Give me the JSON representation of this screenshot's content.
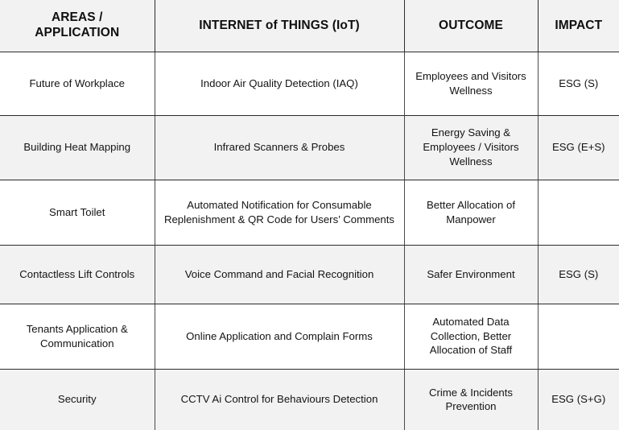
{
  "table": {
    "columns": [
      {
        "key": "areas",
        "label": "AREAS /\nAPPLICATION",
        "label_line1": "AREAS /",
        "label_line2": "APPLICATION"
      },
      {
        "key": "iot",
        "label": "INTERNET of THINGS (IoT)"
      },
      {
        "key": "outcome",
        "label": "OUTCOME"
      },
      {
        "key": "impact",
        "label": "IMPACT"
      }
    ],
    "header": {
      "areas_line1": "AREAS /",
      "areas_line2": "APPLICATION",
      "iot": "INTERNET of THINGS (IoT)",
      "outcome": "OUTCOME",
      "impact": "IMPACT"
    },
    "rows": [
      {
        "areas": "Future of Workplace",
        "iot": "Indoor Air Quality Detection (IAQ)",
        "outcome": "Employees and Visitors Wellness",
        "impact": "ESG (S)"
      },
      {
        "areas": "Building Heat Mapping",
        "iot": "Infrared Scanners & Probes",
        "outcome": "Energy Saving & Employees / Visitors Wellness",
        "impact": "ESG (E+S)"
      },
      {
        "areas": "Smart Toilet",
        "iot": "Automated Notification for Consumable Replenishment & QR Code for Users’ Comments",
        "outcome": "Better Allocation of Manpower",
        "impact": ""
      },
      {
        "areas": "Contactless Lift Controls",
        "iot": "Voice Command and Facial Recognition",
        "outcome": "Safer Environment",
        "impact": "ESG (S)"
      },
      {
        "areas": "Tenants Application & Communication",
        "iot": "Online Application and Complain Forms",
        "outcome": "Automated Data Collection, Better Allocation of Staff",
        "impact": ""
      },
      {
        "areas": "Security",
        "iot": "CCTV Ai Control for Behaviours Detection",
        "outcome": "Crime & Incidents Prevention",
        "impact": "ESG (S+G)"
      }
    ]
  },
  "colors": {
    "header_background": "#f2f2f2",
    "shaded_row_background": "#f2f2f2",
    "plain_row_background": "#ffffff",
    "border": "#2b2b2b",
    "text": "#141414"
  }
}
